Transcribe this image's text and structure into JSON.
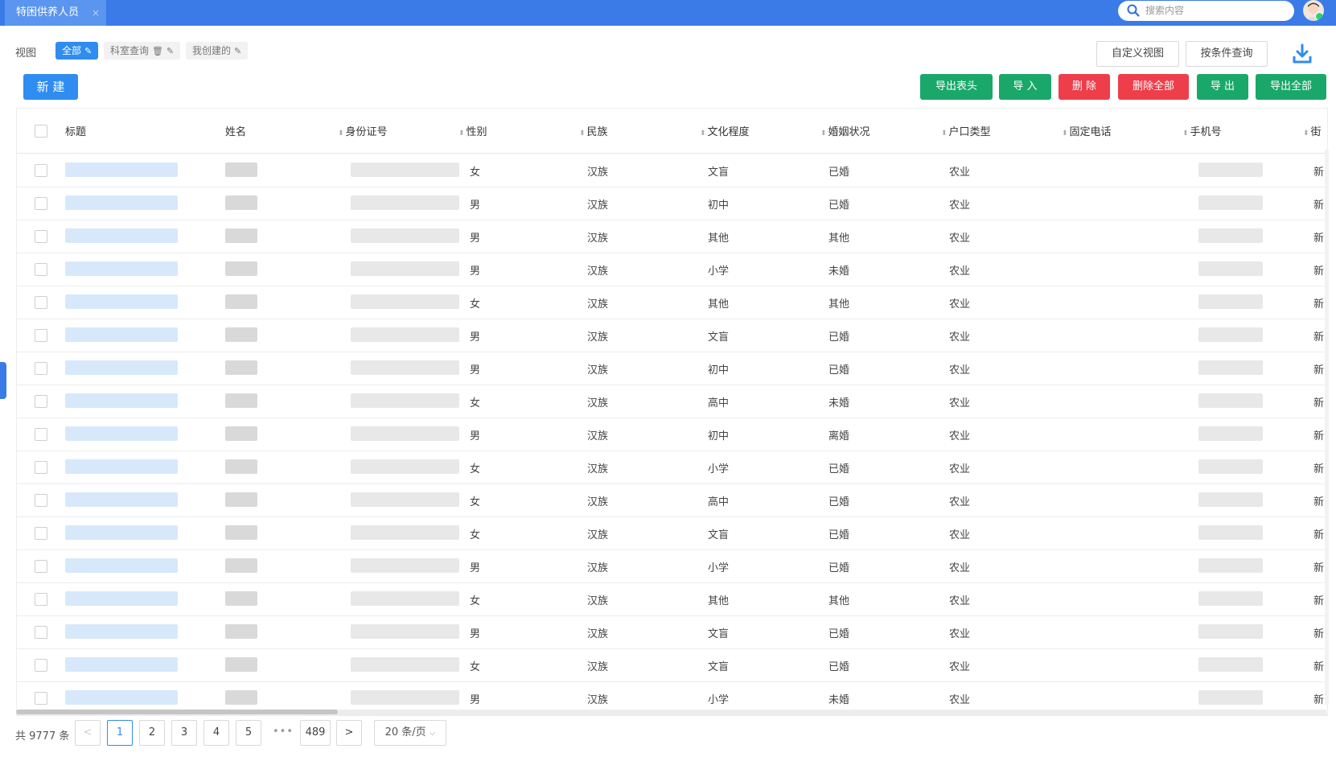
{
  "header": {
    "tab_title": "特困供养人员",
    "tab_close": "×",
    "search_placeholder": "搜索内容"
  },
  "views": {
    "label": "视图",
    "items": [
      {
        "label": "全部",
        "active": true
      },
      {
        "label": "科室查询",
        "active": false
      },
      {
        "label": "我创建的",
        "active": false
      }
    ]
  },
  "toolbar": {
    "custom_view": "自定义视图",
    "conditional_query": "按条件查询",
    "new": "新 建",
    "export_header": "导出表头",
    "import": "导 入",
    "delete": "删 除",
    "delete_all": "删除全部",
    "export": "导 出",
    "export_all": "导出全部"
  },
  "table": {
    "columns": [
      "标题",
      "姓名",
      "身份证号",
      "性别",
      "民族",
      "文化程度",
      "婚姻状况",
      "户口类型",
      "固定电话",
      "手机号",
      "街"
    ],
    "rows": [
      {
        "gender": "女",
        "ethnicity": "汉族",
        "education": "文盲",
        "marital": "已婚",
        "hukou": "农业",
        "street": "新"
      },
      {
        "gender": "男",
        "ethnicity": "汉族",
        "education": "初中",
        "marital": "已婚",
        "hukou": "农业",
        "street": "新"
      },
      {
        "gender": "男",
        "ethnicity": "汉族",
        "education": "其他",
        "marital": "其他",
        "hukou": "农业",
        "street": "新"
      },
      {
        "gender": "男",
        "ethnicity": "汉族",
        "education": "小学",
        "marital": "未婚",
        "hukou": "农业",
        "street": "新"
      },
      {
        "gender": "女",
        "ethnicity": "汉族",
        "education": "其他",
        "marital": "其他",
        "hukou": "农业",
        "street": "新"
      },
      {
        "gender": "男",
        "ethnicity": "汉族",
        "education": "文盲",
        "marital": "已婚",
        "hukou": "农业",
        "street": "新"
      },
      {
        "gender": "男",
        "ethnicity": "汉族",
        "education": "初中",
        "marital": "已婚",
        "hukou": "农业",
        "street": "新"
      },
      {
        "gender": "女",
        "ethnicity": "汉族",
        "education": "高中",
        "marital": "未婚",
        "hukou": "农业",
        "street": "新"
      },
      {
        "gender": "男",
        "ethnicity": "汉族",
        "education": "初中",
        "marital": "离婚",
        "hukou": "农业",
        "street": "新"
      },
      {
        "gender": "女",
        "ethnicity": "汉族",
        "education": "小学",
        "marital": "已婚",
        "hukou": "农业",
        "street": "新"
      },
      {
        "gender": "女",
        "ethnicity": "汉族",
        "education": "高中",
        "marital": "已婚",
        "hukou": "农业",
        "street": "新"
      },
      {
        "gender": "女",
        "ethnicity": "汉族",
        "education": "文盲",
        "marital": "已婚",
        "hukou": "农业",
        "street": "新"
      },
      {
        "gender": "男",
        "ethnicity": "汉族",
        "education": "小学",
        "marital": "已婚",
        "hukou": "农业",
        "street": "新"
      },
      {
        "gender": "女",
        "ethnicity": "汉族",
        "education": "其他",
        "marital": "其他",
        "hukou": "农业",
        "street": "新"
      },
      {
        "gender": "男",
        "ethnicity": "汉族",
        "education": "文盲",
        "marital": "已婚",
        "hukou": "农业",
        "street": "新"
      },
      {
        "gender": "女",
        "ethnicity": "汉族",
        "education": "文盲",
        "marital": "已婚",
        "hukou": "农业",
        "street": "新"
      },
      {
        "gender": "男",
        "ethnicity": "汉族",
        "education": "小学",
        "marital": "未婚",
        "hukou": "农业",
        "street": "新"
      }
    ]
  },
  "pagination": {
    "total": "共 9777 条",
    "pages": [
      "1",
      "2",
      "3",
      "4",
      "5"
    ],
    "ellipsis": "•••",
    "last_page": "489",
    "current": "1",
    "page_size": "20 条/页",
    "prev": "<",
    "next": ">"
  },
  "colors": {
    "primary": "#2f8cf0",
    "topbar": "#3b7be8",
    "green": "#1aa86a",
    "red": "#ee3e4a"
  }
}
